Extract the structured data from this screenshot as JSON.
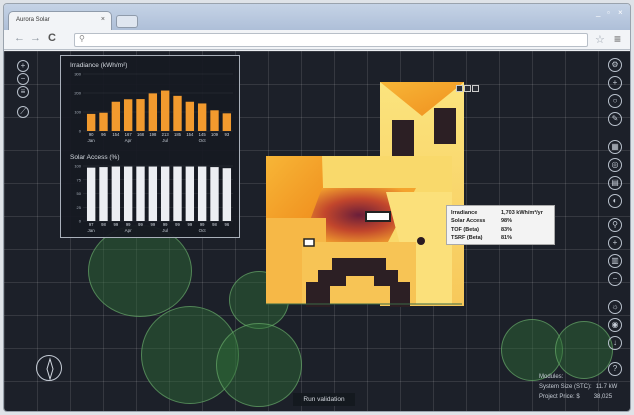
{
  "browser": {
    "tab_title": "Aurora Solar",
    "tab_close": "×",
    "window_controls": [
      "_",
      "▫",
      "×"
    ],
    "nav": {
      "back": "←",
      "forward": "→",
      "reload": "C"
    },
    "address_icon": "search-icon",
    "address_value": "",
    "star": "☆",
    "menu": "≡"
  },
  "irradiance_chart": {
    "title": "Irradiance (kWh/m²)",
    "chart_data": {
      "type": "bar",
      "categories": [
        "Jan",
        "Feb",
        "Mar",
        "Apr",
        "May",
        "Jun",
        "Jul",
        "Aug",
        "Sep",
        "Oct",
        "Nov",
        "Dec"
      ],
      "values": [
        90,
        96,
        154,
        167,
        168,
        198,
        213,
        185,
        154,
        145,
        109,
        93
      ],
      "value_labels": [
        "90",
        "96",
        "154",
        "167",
        "168",
        "198",
        "213",
        "185",
        "154",
        "145",
        "109",
        "93"
      ],
      "tick_labels": [
        "Jan",
        "Apr",
        "Jul",
        "Oct"
      ],
      "ylim": [
        0,
        300
      ],
      "yticks": [
        "300",
        "200",
        "100",
        "0"
      ],
      "color": "#f29a2e"
    }
  },
  "solar_access_chart": {
    "title": "Solar Access (%)",
    "chart_data": {
      "type": "bar",
      "categories": [
        "Jan",
        "Feb",
        "Mar",
        "Apr",
        "May",
        "Jun",
        "Jul",
        "Aug",
        "Sep",
        "Oct",
        "Nov",
        "Dec"
      ],
      "values": [
        97,
        98,
        99,
        99,
        99,
        99,
        99,
        99,
        99,
        99,
        98,
        96
      ],
      "value_labels": [
        "97",
        "98",
        "99",
        "99",
        "99",
        "99",
        "99",
        "99",
        "99",
        "99",
        "98",
        "96"
      ],
      "tick_labels": [
        "Jan",
        "Apr",
        "Jul",
        "Oct"
      ],
      "ylim": [
        0,
        100
      ],
      "yticks": [
        "100",
        "75",
        "50",
        "25",
        "0"
      ],
      "color": "#eceef2"
    }
  },
  "tooltip": {
    "rows": [
      {
        "key": "Irradiance",
        "value": "1,703 kWh/m²/yr"
      },
      {
        "key": "Solar Access",
        "value": "98%"
      },
      {
        "key": "TOF (Beta)",
        "value": "83%"
      },
      {
        "key": "TSRF (Beta)",
        "value": "81%"
      }
    ]
  },
  "run_validation": "Run validation",
  "info": {
    "modules_label": "Modules:",
    "modules_value": "",
    "system_size_label": "System Size (STC):",
    "system_size_value": "11.7 kW",
    "price_label": "Project Price: $",
    "price_value": "38,025"
  },
  "left_tools": [
    "zoom-in-icon",
    "zoom-out-icon",
    "layers-icon",
    "ruler-icon"
  ],
  "right_tools": [
    "settings-icon",
    "add-icon",
    "circle-icon",
    "pencil-icon",
    "panel-icon",
    "target-icon",
    "grid-icon",
    "shade-icon",
    "search-icon",
    "plus-icon",
    "delete-icon",
    "minus-icon",
    "sun-icon",
    "camera-icon",
    "download-icon",
    "help-icon"
  ],
  "colors": {
    "canvas": "#1c2029",
    "roof_bright": "#fbe27a",
    "roof_orange": "#f5a623",
    "roof_dark": "#4a1a2c"
  }
}
